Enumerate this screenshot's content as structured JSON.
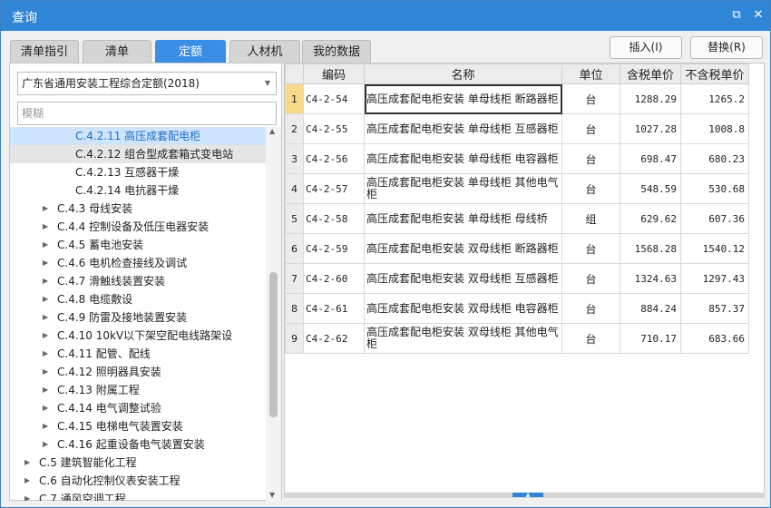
{
  "window": {
    "title": "查询",
    "restore_glyph": "⧉",
    "maximize_glyph": "▫",
    "close_glyph": "✕"
  },
  "tabs": [
    "清单指引",
    "清单",
    "定额",
    "人材机",
    "我的数据"
  ],
  "active_tab": 2,
  "buttons": {
    "insert": "插入(I)",
    "replace": "替换(R)"
  },
  "left": {
    "dropdown_value": "广东省通用安装工程综合定额(2018)",
    "search_placeholder": "模糊"
  },
  "tree": [
    {
      "label": "C.4.2.11 高压成套配电柜",
      "level": 3,
      "state": "selected",
      "arrow": false
    },
    {
      "label": "C.4.2.12 组合型成套箱式变电站",
      "level": 3,
      "state": "hover",
      "arrow": false
    },
    {
      "label": "C.4.2.13 互感器干燥",
      "level": 3,
      "state": "",
      "arrow": false
    },
    {
      "label": "C.4.2.14 电抗器干燥",
      "level": 3,
      "state": "",
      "arrow": false
    },
    {
      "label": "C.4.3 母线安装",
      "level": 2,
      "state": "",
      "arrow": true
    },
    {
      "label": "C.4.4 控制设备及低压电器安装",
      "level": 2,
      "state": "",
      "arrow": true
    },
    {
      "label": "C.4.5 蓄电池安装",
      "level": 2,
      "state": "",
      "arrow": true
    },
    {
      "label": "C.4.6 电机检查接线及调试",
      "level": 2,
      "state": "",
      "arrow": true
    },
    {
      "label": "C.4.7 滑触线装置安装",
      "level": 2,
      "state": "",
      "arrow": true
    },
    {
      "label": "C.4.8 电缆敷设",
      "level": 2,
      "state": "",
      "arrow": true
    },
    {
      "label": "C.4.9 防雷及接地装置安装",
      "level": 2,
      "state": "",
      "arrow": true
    },
    {
      "label": "C.4.10 10kV以下架空配电线路架设",
      "level": 2,
      "state": "",
      "arrow": true
    },
    {
      "label": "C.4.11 配管、配线",
      "level": 2,
      "state": "",
      "arrow": true
    },
    {
      "label": "C.4.12 照明器具安装",
      "level": 2,
      "state": "",
      "arrow": true
    },
    {
      "label": "C.4.13 附属工程",
      "level": 2,
      "state": "",
      "arrow": true
    },
    {
      "label": "C.4.14 电气调整试验",
      "level": 2,
      "state": "",
      "arrow": true
    },
    {
      "label": "C.4.15 电梯电气装置安装",
      "level": 2,
      "state": "",
      "arrow": true
    },
    {
      "label": "C.4.16 起重设备电气装置安装",
      "level": 2,
      "state": "",
      "arrow": true
    },
    {
      "label": "C.5 建筑智能化工程",
      "level": 1,
      "state": "",
      "arrow": true
    },
    {
      "label": "C.6 自动化控制仪表安装工程",
      "level": 1,
      "state": "",
      "arrow": true
    },
    {
      "label": "C.7 通风空调工程",
      "level": 1,
      "state": "",
      "arrow": true
    }
  ],
  "table": {
    "headers": [
      "",
      "编码",
      "名称",
      "单位",
      "含税单价",
      "不含税单价"
    ],
    "rows": [
      {
        "idx": "1",
        "code": "C4-2-54",
        "name": "高压成套配电柜安装 单母线柜 断路器柜",
        "unit": "台",
        "tax_price": "1288.29",
        "notax_price": "1265.2"
      },
      {
        "idx": "2",
        "code": "C4-2-55",
        "name": "高压成套配电柜安装 单母线柜 互感器柜",
        "unit": "台",
        "tax_price": "1027.28",
        "notax_price": "1008.8"
      },
      {
        "idx": "3",
        "code": "C4-2-56",
        "name": "高压成套配电柜安装 单母线柜 电容器柜",
        "unit": "台",
        "tax_price": "698.47",
        "notax_price": "680.23"
      },
      {
        "idx": "4",
        "code": "C4-2-57",
        "name": "高压成套配电柜安装 单母线柜 其他电气柜",
        "unit": "台",
        "tax_price": "548.59",
        "notax_price": "530.68"
      },
      {
        "idx": "5",
        "code": "C4-2-58",
        "name": "高压成套配电柜安装 单母线柜 母线桥",
        "unit": "组",
        "tax_price": "629.62",
        "notax_price": "607.36"
      },
      {
        "idx": "6",
        "code": "C4-2-59",
        "name": "高压成套配电柜安装 双母线柜 断路器柜",
        "unit": "台",
        "tax_price": "1568.28",
        "notax_price": "1540.12"
      },
      {
        "idx": "7",
        "code": "C4-2-60",
        "name": "高压成套配电柜安装 双母线柜 互感器柜",
        "unit": "台",
        "tax_price": "1324.63",
        "notax_price": "1297.43"
      },
      {
        "idx": "8",
        "code": "C4-2-61",
        "name": "高压成套配电柜安装 双母线柜 电容器柜",
        "unit": "台",
        "tax_price": "884.24",
        "notax_price": "857.37"
      },
      {
        "idx": "9",
        "code": "C4-2-62",
        "name": "高压成套配电柜安装 双母线柜 其他电气柜",
        "unit": "台",
        "tax_price": "710.17",
        "notax_price": "683.66"
      }
    ]
  }
}
